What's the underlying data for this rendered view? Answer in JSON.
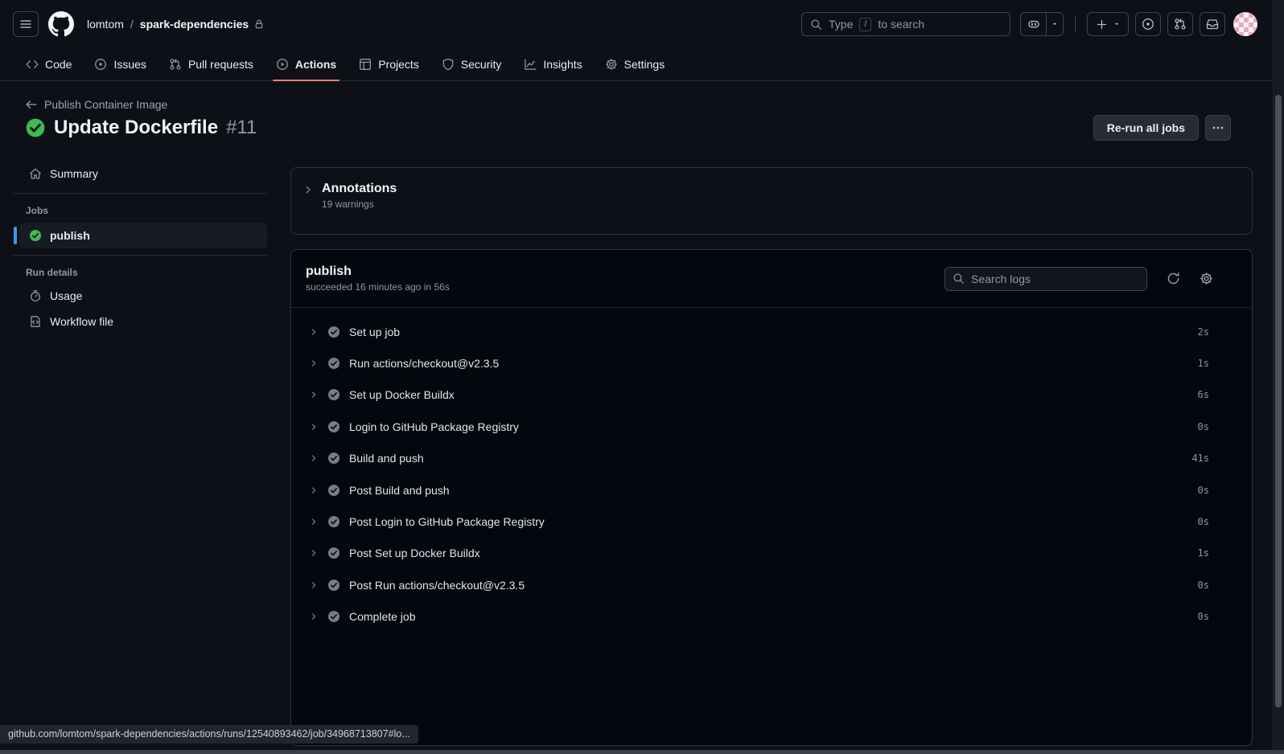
{
  "header": {
    "breadcrumb": {
      "owner": "lomtom",
      "separator": "/",
      "repo": "spark-dependencies"
    },
    "search": {
      "prefix": "Type",
      "slash_key": "/",
      "suffix": "to search"
    },
    "icons": [
      "hamburger-icon",
      "github-logo",
      "lock-icon",
      "search-icon",
      "copilot-icon",
      "caret-down-icon",
      "plus-icon",
      "issue-opened-icon",
      "pull-request-icon",
      "inbox-icon",
      "avatar"
    ]
  },
  "nav": {
    "tabs": [
      {
        "label": "Code",
        "icon": "code-icon",
        "active": false
      },
      {
        "label": "Issues",
        "icon": "issue-opened-icon",
        "active": false
      },
      {
        "label": "Pull requests",
        "icon": "pull-request-icon",
        "active": false
      },
      {
        "label": "Actions",
        "icon": "play-circle-icon",
        "active": true
      },
      {
        "label": "Projects",
        "icon": "table-icon",
        "active": false
      },
      {
        "label": "Security",
        "icon": "shield-icon",
        "active": false
      },
      {
        "label": "Insights",
        "icon": "graph-icon",
        "active": false
      },
      {
        "label": "Settings",
        "icon": "gear-icon",
        "active": false
      }
    ],
    "active_underline_color": "#f78166"
  },
  "run": {
    "back_label": "Publish Container Image",
    "title": "Update Dockerfile",
    "number": "#11",
    "status": "success",
    "rerun_button": "Re-run all jobs",
    "success_color": "#3fb950"
  },
  "sidebar": {
    "summary": "Summary",
    "jobs_label": "Jobs",
    "job": {
      "name": "publish",
      "status": "success",
      "selected": true,
      "selection_color": "#4493f8"
    },
    "run_details_label": "Run details",
    "usage": "Usage",
    "workflow_file": "Workflow file"
  },
  "annotations": {
    "title": "Annotations",
    "subtitle": "19 warnings"
  },
  "job_panel": {
    "title": "publish",
    "status_line": "succeeded 16 minutes ago in 56s",
    "search_placeholder": "Search logs",
    "icons": [
      "sync-icon",
      "gear-icon"
    ]
  },
  "steps": [
    {
      "name": "Set up job",
      "duration": "2s",
      "status": "success"
    },
    {
      "name": "Run actions/checkout@v2.3.5",
      "duration": "1s",
      "status": "success"
    },
    {
      "name": "Set up Docker Buildx",
      "duration": "6s",
      "status": "success"
    },
    {
      "name": "Login to GitHub Package Registry",
      "duration": "0s",
      "status": "success"
    },
    {
      "name": "Build and push",
      "duration": "41s",
      "status": "success"
    },
    {
      "name": "Post Build and push",
      "duration": "0s",
      "status": "success"
    },
    {
      "name": "Post Login to GitHub Package Registry",
      "duration": "0s",
      "status": "success"
    },
    {
      "name": "Post Set up Docker Buildx",
      "duration": "1s",
      "status": "success"
    },
    {
      "name": "Post Run actions/checkout@v2.3.5",
      "duration": "0s",
      "status": "success"
    },
    {
      "name": "Complete job",
      "duration": "0s",
      "status": "success"
    }
  ],
  "statusbar": {
    "url": "github.com/lomtom/spark-dependencies/actions/runs/12540893462/job/34968713807#lo..."
  }
}
